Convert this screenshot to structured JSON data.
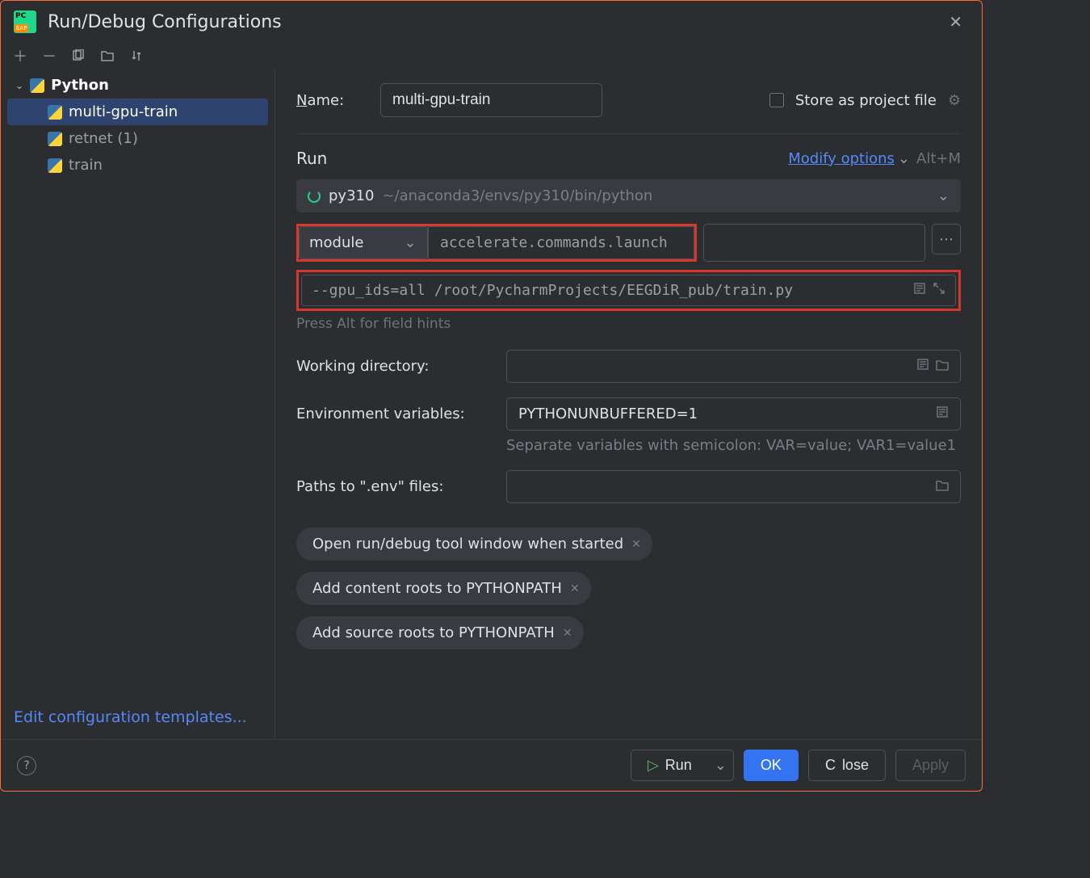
{
  "dialog": {
    "title": "Run/Debug Configurations"
  },
  "tree": {
    "category": "Python",
    "items": [
      {
        "label": "multi-gpu-train",
        "selected": true
      },
      {
        "label": "retnet (1)",
        "selected": false
      },
      {
        "label": "train",
        "selected": false
      }
    ]
  },
  "edit_templates": "Edit configuration templates...",
  "name": {
    "label": "Name:",
    "value": "multi-gpu-train"
  },
  "store": {
    "label": "Store as project file"
  },
  "run_section": {
    "title": "Run",
    "modify": "Modify options",
    "shortcut": "Alt+M"
  },
  "interpreter": {
    "name": "py310",
    "path": "~/anaconda3/envs/py310/bin/python"
  },
  "target_type": "module",
  "target_value": "accelerate.commands.launch",
  "parameters": "--gpu_ids=all /root/PycharmProjects/EEGDiR_pub/train.py",
  "hint": "Press Alt for field hints",
  "workdir": {
    "label": "Working directory:",
    "value": ""
  },
  "envvars": {
    "label": "Environment variables:",
    "value": "PYTHONUNBUFFERED=1",
    "hint": "Separate variables with semicolon: VAR=value; VAR1=value1"
  },
  "envpaths": {
    "label": "Paths to \".env\" files:",
    "value": ""
  },
  "chips": [
    "Open run/debug tool window when started",
    "Add content roots to PYTHONPATH",
    "Add source roots to PYTHONPATH"
  ],
  "buttons": {
    "run": "Run",
    "ok": "OK",
    "close": "Close",
    "apply": "Apply"
  }
}
